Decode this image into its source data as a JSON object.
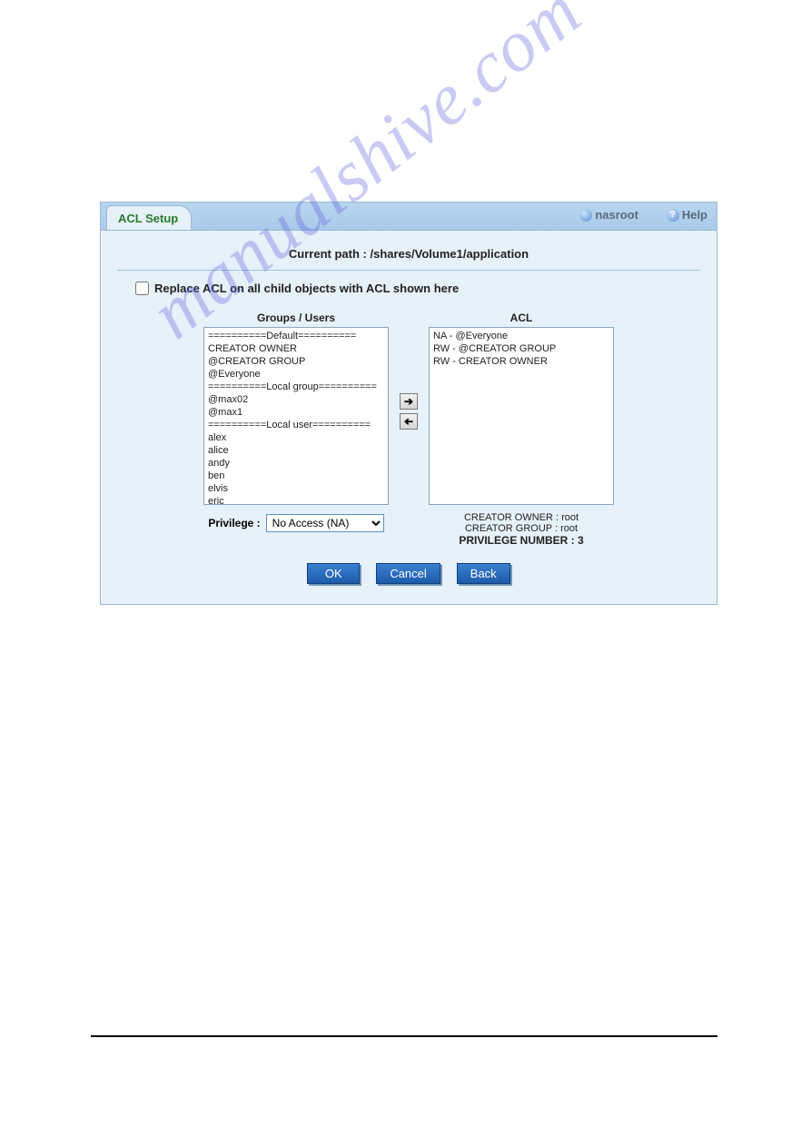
{
  "tab_title": "ACL Setup",
  "user_link": "nasroot",
  "help_link": "Help",
  "path_label": "Current path : /shares/Volume1/application",
  "replace_label": "Replace ACL on all child objects with ACL shown here",
  "left_header": "Groups / Users",
  "right_header": "ACL",
  "groups_users": [
    "==========Default==========",
    "CREATOR OWNER",
    "@CREATOR GROUP",
    "@Everyone",
    "==========Local group==========",
    "@max02",
    "@max1",
    "==========Local user==========",
    "alex",
    "alice",
    "andy",
    "ben",
    "elvis",
    "eric"
  ],
  "acl_entries": [
    "NA - @Everyone",
    "RW - @CREATOR GROUP",
    "RW - CREATOR OWNER"
  ],
  "privilege_label": "Privilege :",
  "privilege_selected": "No Access (NA)",
  "creator_owner_line": "CREATOR OWNER : root",
  "creator_group_line": "CREATOR GROUP : root",
  "priv_number_line": "PRIVILEGE NUMBER : 3",
  "buttons": {
    "ok": "OK",
    "cancel": "Cancel",
    "back": "Back"
  },
  "watermark": "manualshive.com"
}
